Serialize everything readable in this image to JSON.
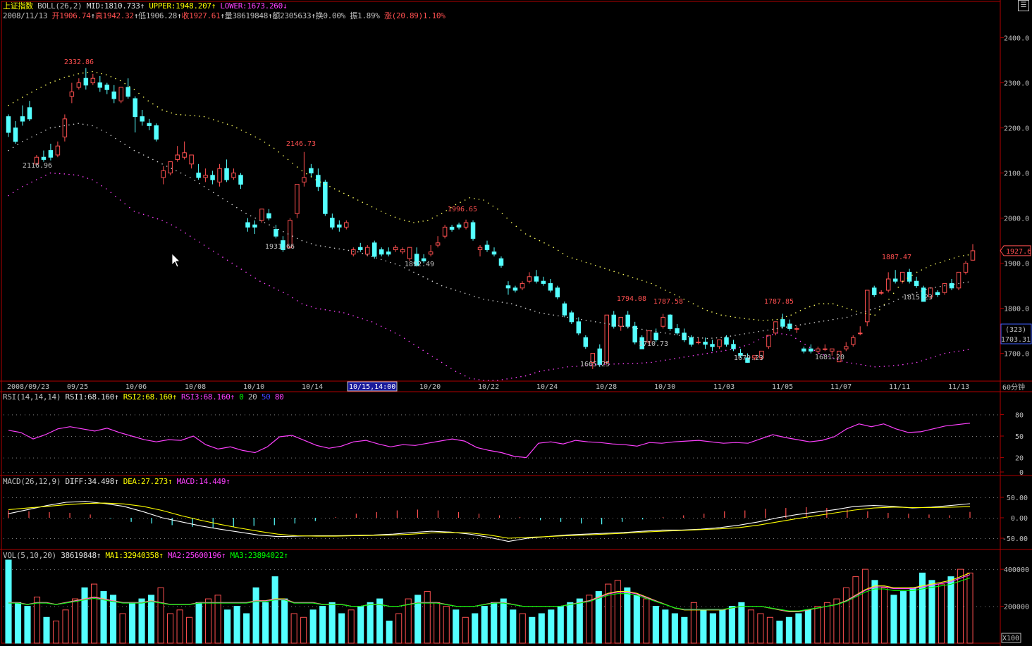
{
  "header": {
    "title": "上证指数",
    "boll": "BOLL(26,2)",
    "mid": "MID:1810.733",
    "upper": "UPPER:1948.207",
    "lower": "LOWER:1673.260",
    "date": "2008/11/13",
    "open": "开1906.74",
    "high": "高1942.32",
    "low": "低1906.28",
    "close": "收1927.61",
    "volume": "量38619848",
    "amount": "额2305633",
    "turnover": "换0.00%",
    "amplitude": "振1.89%",
    "change": "涨(20.89)1.10%"
  },
  "rsi_header": {
    "label": "RSI(14,14,14)",
    "rsi1": "RSI1:68.160",
    "rsi2": "RSI2:68.160",
    "rsi3": "RSI3:68.160",
    "l0": "0",
    "l20": "20",
    "l50": "50",
    "l80": "80"
  },
  "macd_header": {
    "label": "MACD(26,12,9)",
    "diff": "DIFF:34.498",
    "dea": "DEA:27.273",
    "macd": "MACD:14.449"
  },
  "vol_header": {
    "label": "VOL(5,10,20)",
    "vol": "38619848",
    "ma1": "MA1:32940358",
    "ma2": "MA2:25600196",
    "ma3": "MA3:23894022"
  },
  "time_axis": {
    "labels": [
      "2008/09/23",
      "09/25",
      "10/06",
      "10/08",
      "10/10",
      "10/14",
      "10/15,14:00",
      "10/20",
      "10/22",
      "10/24",
      "10/28",
      "10/30",
      "11/03",
      "11/05",
      "11/07",
      "11/11",
      "11/13"
    ],
    "period": "60分钟"
  },
  "price_axis": {
    "ticks": [
      "2400.0",
      "2300.0",
      "2200.0",
      "2100.0",
      "2000.0",
      "1900.0",
      "1800.0",
      "1700.0"
    ],
    "current": "1927.6",
    "cursor_count": "(323)",
    "cursor_price": "1703.31"
  },
  "rsi_axis": {
    "ticks": [
      "80",
      "50",
      "20",
      "0"
    ]
  },
  "macd_axis": {
    "ticks": [
      "50.00",
      "0.00",
      "-50.00"
    ]
  },
  "vol_axis": {
    "ticks": [
      "400000",
      "200000"
    ],
    "unit": "X100"
  },
  "annotations": [
    "2332.86",
    "2116.96",
    "2146.73",
    "1931.66",
    "1996.65",
    "1892.49",
    "1794.08",
    "1787.58",
    "1665.25",
    "1710.73",
    "1787.85",
    "1679.23",
    "1681.20",
    "1887.47",
    "1815.23"
  ],
  "colors": {
    "up": "#ff5050",
    "down": "#54ffff",
    "rsi": "#ff40ff",
    "diff": "#ffffff",
    "dea": "#ffff00",
    "ma1": "#ffff00",
    "ma2": "#ff40ff",
    "ma3": "#00ff00",
    "frame": "#b00000"
  },
  "chart_data": {
    "type": "candlestick",
    "title": "上证指数",
    "ylim": [
      1640,
      2440
    ],
    "candles": [
      [
        2225,
        2230,
        2190,
        2180
      ],
      [
        2200,
        2215,
        2170,
        2165
      ],
      [
        2225,
        2250,
        2215,
        2205
      ],
      [
        2245,
        2260,
        2220,
        2215
      ],
      [
        2120,
        2140,
        2135,
        2125
      ],
      [
        2135,
        2150,
        2130,
        2125
      ],
      [
        2150,
        2165,
        2135,
        2128
      ],
      [
        2140,
        2170,
        2160,
        2135
      ],
      [
        2180,
        2230,
        2220,
        2170
      ],
      [
        2270,
        2300,
        2280,
        2255
      ],
      [
        2290,
        2310,
        2300,
        2285
      ],
      [
        2310,
        2332.86,
        2295,
        2285
      ],
      [
        2300,
        2320,
        2310,
        2295
      ],
      [
        2300,
        2315,
        2290,
        2280
      ],
      [
        2295,
        2300,
        2285,
        2275
      ],
      [
        2280,
        2295,
        2265,
        2255
      ],
      [
        2260,
        2280,
        2290,
        2255
      ],
      [
        2290,
        2310,
        2270,
        2265
      ],
      [
        2265,
        2270,
        2225,
        2190
      ],
      [
        2225,
        2240,
        2215,
        2205
      ],
      [
        2210,
        2220,
        2205,
        2195
      ],
      [
        2205,
        2210,
        2175,
        2170
      ],
      [
        2090,
        2115,
        2105,
        2075
      ],
      [
        2100,
        2120,
        2125,
        2095
      ],
      [
        2130,
        2160,
        2140,
        2125
      ],
      [
        2135,
        2170,
        2145,
        2130
      ],
      [
        2120,
        2130,
        2140,
        2110
      ],
      [
        2100,
        2120,
        2090,
        2085
      ],
      [
        2090,
        2110,
        2095,
        2080
      ],
      [
        2095,
        2105,
        2085,
        2075
      ],
      [
        2080,
        2120,
        2110,
        2070
      ],
      [
        2110,
        2130,
        2085,
        2080
      ],
      [
        2090,
        2110,
        2100,
        2085
      ],
      [
        2095,
        2100,
        2075,
        2065
      ],
      [
        1990,
        2000,
        1980,
        1970
      ],
      [
        1985,
        1995,
        1980,
        1965
      ],
      [
        1995,
        2010,
        2020,
        1990
      ],
      [
        2010,
        2020,
        2000,
        1995
      ],
      [
        1975,
        1985,
        1960,
        1955
      ],
      [
        1950,
        1960,
        1930,
        1925
      ],
      [
        1935,
        2000,
        1995,
        1931.66
      ],
      [
        2010,
        2070,
        2075,
        2000
      ],
      [
        2080,
        2146.73,
        2090,
        2070
      ],
      [
        2110,
        2120,
        2100,
        2090
      ],
      [
        2095,
        2110,
        2070,
        2060
      ],
      [
        2080,
        2085,
        2010,
        2005
      ],
      [
        2000,
        2010,
        1980,
        1975
      ],
      [
        1985,
        1995,
        1980,
        1970
      ],
      [
        1980,
        1995,
        1990,
        1975
      ],
      [
        1920,
        1935,
        1930,
        1915
      ],
      [
        1935,
        1945,
        1930,
        1925
      ],
      [
        1920,
        1940,
        1935,
        1915
      ],
      [
        1945,
        1950,
        1915,
        1910
      ],
      [
        1930,
        1935,
        1920,
        1915
      ],
      [
        1925,
        1935,
        1920,
        1915
      ],
      [
        1930,
        1940,
        1935,
        1925
      ],
      [
        1925,
        1935,
        1930,
        1920
      ],
      [
        1910,
        1920,
        1935,
        1905
      ],
      [
        1920,
        1935,
        1895,
        1892.49
      ],
      [
        1910,
        1920,
        1905,
        1900
      ],
      [
        1920,
        1940,
        1925,
        1915
      ],
      [
        1940,
        1960,
        1945,
        1935
      ],
      [
        1960,
        1985,
        1980,
        1955
      ],
      [
        1980,
        1985,
        1975,
        1970
      ],
      [
        1985,
        1990,
        1980,
        1975
      ],
      [
        1980,
        1996.65,
        1990,
        1975
      ],
      [
        1990,
        1995,
        1955,
        1950
      ],
      [
        1930,
        1940,
        1935,
        1915
      ],
      [
        1940,
        1950,
        1930,
        1925
      ],
      [
        1925,
        1935,
        1920,
        1915
      ],
      [
        1910,
        1915,
        1895,
        1890
      ],
      [
        1850,
        1860,
        1845,
        1830
      ],
      [
        1845,
        1850,
        1840,
        1835
      ],
      [
        1845,
        1860,
        1855,
        1840
      ],
      [
        1860,
        1880,
        1870,
        1855
      ],
      [
        1870,
        1885,
        1860,
        1855
      ],
      [
        1860,
        1870,
        1855,
        1850
      ],
      [
        1855,
        1865,
        1840,
        1835
      ],
      [
        1845,
        1850,
        1825,
        1820
      ],
      [
        1810,
        1815,
        1785,
        1780
      ],
      [
        1790,
        1795,
        1770,
        1765
      ],
      [
        1770,
        1780,
        1745,
        1740
      ],
      [
        1735,
        1740,
        1715,
        1710
      ],
      [
        1680,
        1690,
        1700,
        1665.25
      ],
      [
        1710,
        1720,
        1675,
        1670
      ],
      [
        1680,
        1690,
        1785,
        1675
      ],
      [
        1785,
        1794.08,
        1760,
        1755
      ],
      [
        1760,
        1775,
        1780,
        1750
      ],
      [
        1785,
        1794,
        1760,
        1755
      ],
      [
        1760,
        1770,
        1725,
        1720
      ],
      [
        1735,
        1740,
        1710,
        1710.73
      ],
      [
        1725,
        1740,
        1750,
        1720
      ],
      [
        1745,
        1755,
        1730,
        1725
      ],
      [
        1760,
        1787.58,
        1780,
        1755
      ],
      [
        1785,
        1787,
        1755,
        1750
      ],
      [
        1755,
        1765,
        1745,
        1740
      ],
      [
        1745,
        1755,
        1730,
        1725
      ],
      [
        1735,
        1740,
        1720,
        1715
      ],
      [
        1725,
        1735,
        1725,
        1720
      ],
      [
        1725,
        1735,
        1720,
        1710
      ],
      [
        1720,
        1730,
        1715,
        1705
      ],
      [
        1715,
        1725,
        1730,
        1710
      ],
      [
        1735,
        1740,
        1720,
        1715
      ],
      [
        1720,
        1730,
        1710,
        1705
      ],
      [
        1700,
        1710,
        1695,
        1690
      ],
      [
        1690,
        1700,
        1680,
        1679.23
      ],
      [
        1690,
        1695,
        1695,
        1685
      ],
      [
        1690,
        1705,
        1705,
        1685
      ],
      [
        1715,
        1720,
        1740,
        1710
      ],
      [
        1745,
        1760,
        1770,
        1740
      ],
      [
        1775,
        1787.85,
        1760,
        1755
      ],
      [
        1765,
        1775,
        1755,
        1750
      ],
      [
        1755,
        1760,
        1755,
        1745
      ],
      [
        1710,
        1715,
        1705,
        1700
      ],
      [
        1710,
        1720,
        1705,
        1700
      ],
      [
        1705,
        1715,
        1710,
        1700
      ],
      [
        1710,
        1720,
        1710,
        1705
      ],
      [
        1705,
        1710,
        1710,
        1695
      ],
      [
        1681.2,
        1700,
        1705,
        1681.2
      ],
      [
        1710,
        1725,
        1715,
        1705
      ],
      [
        1720,
        1740,
        1735,
        1715
      ],
      [
        1745,
        1760,
        1745,
        1740
      ],
      [
        1770,
        1835,
        1840,
        1760
      ],
      [
        1845,
        1850,
        1830,
        1825
      ],
      [
        1835,
        1840,
        1835,
        1830
      ],
      [
        1840,
        1880,
        1865,
        1835
      ],
      [
        1865,
        1885,
        1860,
        1855
      ],
      [
        1860,
        1875,
        1880,
        1855
      ],
      [
        1880,
        1887.47,
        1860,
        1855
      ],
      [
        1860,
        1870,
        1850,
        1845
      ],
      [
        1845,
        1850,
        1815.23,
        1815.23
      ],
      [
        1825,
        1845,
        1845,
        1820
      ],
      [
        1835,
        1840,
        1830,
        1825
      ],
      [
        1835,
        1850,
        1855,
        1830
      ],
      [
        1855,
        1865,
        1845,
        1840
      ],
      [
        1845,
        1880,
        1880,
        1840
      ],
      [
        1880,
        1905,
        1900,
        1875
      ],
      [
        1906.74,
        1942.32,
        1927.61,
        1906.28
      ]
    ],
    "boll_upper": [
      2250,
      2268,
      2285,
      2300,
      2312,
      2320,
      2325,
      2318,
      2305,
      2285,
      2260,
      2240,
      2230,
      2228,
      2225,
      2215,
      2205,
      2190,
      2175,
      2155,
      2130,
      2105,
      2085,
      2070,
      2055,
      2040,
      2025,
      2010,
      1998,
      1990,
      1995,
      2010,
      2030,
      2045,
      2040,
      2020,
      1990,
      1965,
      1950,
      1935,
      1915,
      1905,
      1895,
      1885,
      1875,
      1865,
      1855,
      1840,
      1825,
      1810,
      1795,
      1785,
      1780,
      1776,
      1773,
      1775,
      1785,
      1800,
      1810,
      1810,
      1800,
      1790,
      1785,
      1820,
      1860,
      1880,
      1895,
      1905,
      1915,
      1920
    ],
    "boll_mid": [
      2150,
      2170,
      2185,
      2200,
      2205,
      2210,
      2205,
      2190,
      2170,
      2150,
      2135,
      2120,
      2105,
      2090,
      2070,
      2050,
      2030,
      2010,
      1995,
      1980,
      1965,
      1950,
      1940,
      1935,
      1930,
      1925,
      1915,
      1905,
      1895,
      1880,
      1865,
      1850,
      1840,
      1830,
      1820,
      1815,
      1810,
      1800,
      1790,
      1785,
      1780,
      1775,
      1770,
      1765,
      1760,
      1755,
      1750,
      1745,
      1740,
      1736,
      1733,
      1735,
      1740,
      1745,
      1750,
      1755,
      1760,
      1765,
      1770,
      1775,
      1780,
      1790,
      1800,
      1810,
      1825,
      1835,
      1845,
      1850,
      1855,
      1860
    ],
    "boll_lower": [
      2050,
      2070,
      2085,
      2100,
      2098,
      2095,
      2085,
      2065,
      2040,
      2015,
      2005,
      1995,
      1980,
      1960,
      1940,
      1920,
      1900,
      1880,
      1860,
      1845,
      1830,
      1810,
      1800,
      1795,
      1790,
      1780,
      1770,
      1755,
      1740,
      1720,
      1700,
      1680,
      1660,
      1645,
      1640,
      1640,
      1645,
      1650,
      1660,
      1665,
      1670,
      1672,
      1675,
      1676,
      1677,
      1678,
      1680,
      1685,
      1690,
      1695,
      1700,
      1705,
      1710,
      1720,
      1735,
      1745,
      1740,
      1720,
      1700,
      1690,
      1680,
      1675,
      1670,
      1672,
      1675,
      1680,
      1690,
      1700,
      1705,
      1710
    ],
    "rsi": [
      58,
      55,
      46,
      52,
      60,
      63,
      60,
      57,
      61,
      55,
      50,
      45,
      42,
      45,
      44,
      50,
      38,
      32,
      35,
      30,
      27,
      35,
      49,
      51,
      44,
      37,
      33,
      36,
      42,
      44,
      39,
      35,
      38,
      37,
      40,
      43,
      46,
      43,
      34,
      30,
      27,
      22,
      20,
      40,
      42,
      39,
      44,
      42,
      41,
      39,
      38,
      36,
      41,
      40,
      42,
      43,
      44,
      42,
      40,
      41,
      40,
      46,
      52,
      48,
      45,
      42,
      44,
      49,
      60,
      67,
      63,
      67,
      60,
      55,
      56,
      60,
      64,
      66,
      68
    ],
    "diff": [
      10,
      20,
      30,
      38,
      40,
      35,
      28,
      15,
      0,
      -10,
      -20,
      -28,
      -35,
      -42,
      -46,
      -45,
      -44,
      -44,
      -43,
      -42,
      -40,
      -36,
      -33,
      -35,
      -40,
      -48,
      -58,
      -50,
      -46,
      -42,
      -40,
      -38,
      -36,
      -33,
      -30,
      -30,
      -28,
      -24,
      -18,
      -10,
      0,
      8,
      14,
      20,
      28,
      30,
      28,
      24,
      26,
      30,
      34.5
    ],
    "dea": [
      20,
      24,
      28,
      32,
      35,
      36,
      34,
      28,
      18,
      5,
      -6,
      -16,
      -25,
      -33,
      -40,
      -44,
      -45,
      -45,
      -44,
      -43,
      -42,
      -40,
      -37,
      -36,
      -37,
      -42,
      -50,
      -48,
      -46,
      -44,
      -42,
      -40,
      -38,
      -35,
      -33,
      -31,
      -29,
      -27,
      -24,
      -18,
      -10,
      -2,
      5,
      12,
      19,
      24,
      26,
      25,
      25,
      26,
      27.3
    ],
    "macd_hist": [
      18,
      16,
      14,
      12,
      8,
      -2,
      -10,
      -14,
      -18,
      -22,
      -24,
      -22,
      -20,
      -18,
      -14,
      -8,
      2,
      10,
      14,
      18,
      20,
      18,
      14,
      10,
      6,
      2,
      -6,
      -10,
      -14,
      -16,
      -10,
      -4,
      2,
      6,
      10,
      16,
      18,
      22,
      24,
      26,
      24,
      20,
      16,
      12,
      10,
      8,
      6,
      14.4
    ],
    "volume": [
      45,
      22,
      20,
      25,
      14,
      12,
      18,
      24,
      30,
      32,
      28,
      26,
      16,
      22,
      24,
      26,
      30,
      16,
      18,
      14,
      22,
      24,
      26,
      18,
      20,
      16,
      30,
      22,
      36,
      24,
      16,
      14,
      18,
      20,
      22,
      16,
      18,
      20,
      22,
      24,
      12,
      16,
      24,
      26,
      28,
      22,
      20,
      18,
      14,
      16,
      20,
      22,
      24,
      18,
      16,
      14,
      16,
      18,
      20,
      22,
      24,
      26,
      28,
      32,
      34,
      30,
      26,
      24,
      20,
      18,
      16,
      14,
      22,
      18,
      16,
      18,
      20,
      22,
      18,
      16,
      14,
      12,
      14,
      16,
      18,
      20,
      22,
      24,
      30,
      36,
      40,
      34,
      30,
      26,
      28,
      30,
      38,
      34,
      32,
      36,
      40,
      38
    ],
    "vol_ma1": [
      22,
      22,
      21,
      22,
      22,
      21,
      22,
      23,
      24,
      25,
      24,
      23,
      22,
      22,
      22,
      23,
      22,
      21,
      21,
      21,
      22,
      22,
      22,
      22,
      22,
      22,
      23,
      23,
      24,
      24,
      22,
      22,
      22,
      21,
      21,
      21,
      20,
      20,
      21,
      21,
      20,
      20,
      21,
      22,
      22,
      22,
      21,
      20,
      20,
      20,
      21,
      22,
      22,
      21,
      20,
      20,
      20,
      20,
      20,
      21,
      22,
      23,
      25,
      27,
      28,
      28,
      27,
      25,
      23,
      21,
      19,
      18,
      18,
      18,
      18,
      18,
      19,
      20,
      20,
      20,
      19,
      18,
      17,
      17,
      18,
      19,
      20,
      21,
      23,
      26,
      29,
      31,
      31,
      30,
      30,
      30,
      31,
      32,
      33,
      34,
      36,
      38
    ]
  }
}
